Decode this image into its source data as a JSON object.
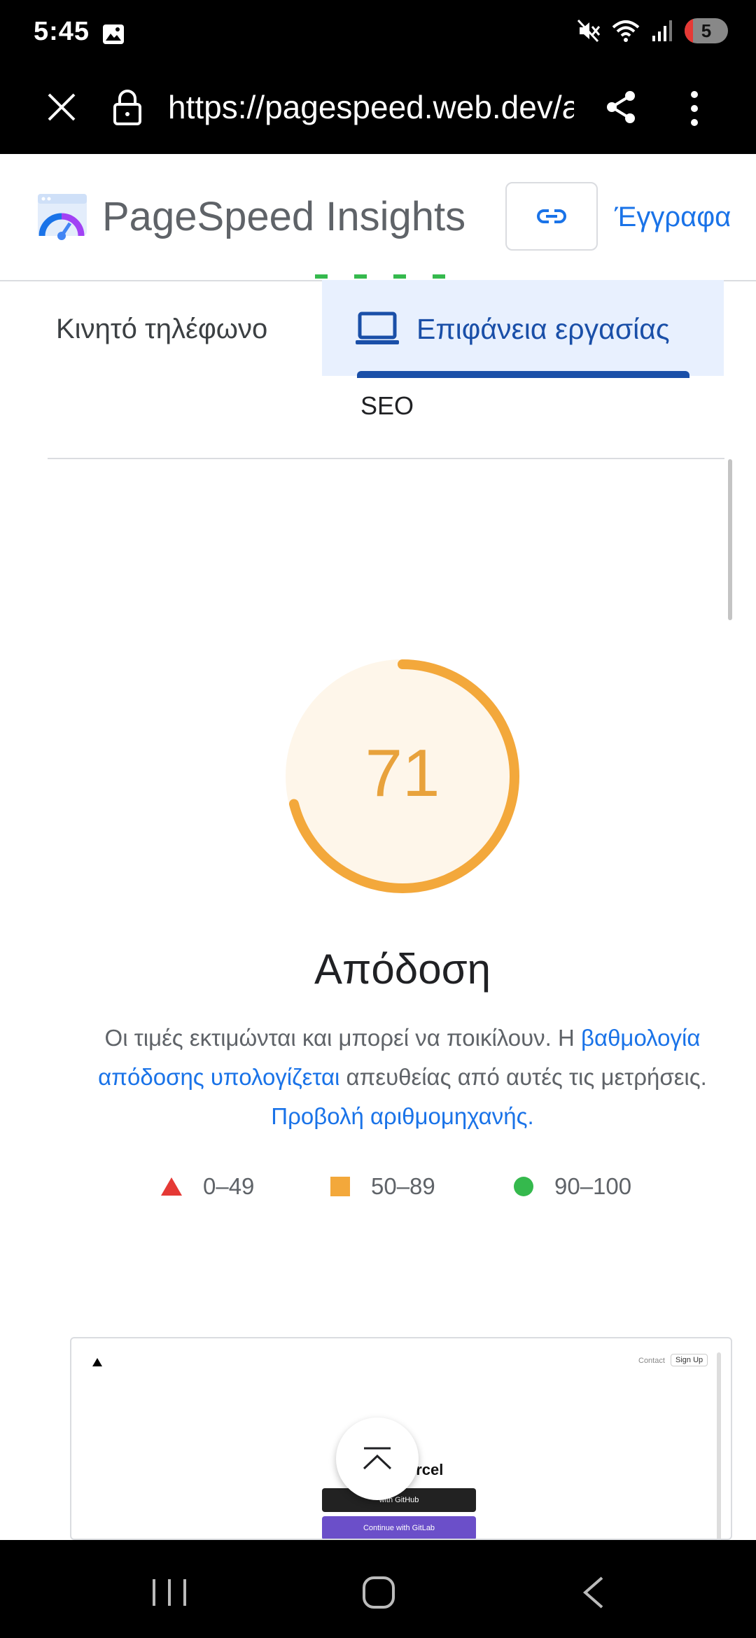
{
  "status_bar": {
    "time": "5:45",
    "notification_count": "5"
  },
  "browser": {
    "url": "https://pagespeed.web.dev/a"
  },
  "header": {
    "title": "PageSpeed Insights",
    "docs_link": "Έγγραφα"
  },
  "tabs": [
    {
      "label": "Κινητό τηλέφωνο",
      "selected": false
    },
    {
      "label": "Επιφάνεια εργασίας",
      "selected": true
    }
  ],
  "category": {
    "label": "SEO"
  },
  "gauge": {
    "score": "71",
    "value": 71,
    "max": 100,
    "color": "#f3a83b"
  },
  "performance": {
    "title": "Απόδοση",
    "desc_part1": "Οι τιμές εκτιμώνται και μπορεί να ποικίλουν. Η ",
    "desc_link1": "βαθμολογία απόδοσης υπολογίζεται",
    "desc_part2": " απευθείας από αυτές τις μετρήσεις. ",
    "desc_link2": "Προβολή αριθμομηχανής."
  },
  "legend": [
    {
      "range": "0–49",
      "color": "#e53935"
    },
    {
      "range": "50–89",
      "color": "#f3a83b"
    },
    {
      "range": "90–100",
      "color": "#35b94d"
    }
  ],
  "preview": {
    "contact": "Contact",
    "signup": "Sign Up",
    "title": "ercel",
    "btn_github": "with GitHub",
    "btn_gitlab": "Continue with GitLab"
  }
}
